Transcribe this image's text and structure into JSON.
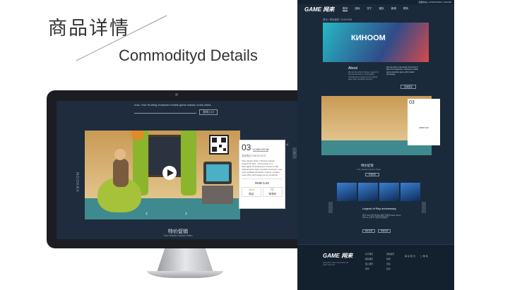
{
  "header": {
    "title_zh": "商品详情",
    "title_en": "Commodityd Details"
  },
  "monitor": {
    "top_text": "now, Your Hunting character mobile game classic cross china",
    "top_button": "游戏入口",
    "side_label": "KИHOOM",
    "card": {
      "number": "03",
      "name": "K-НИ-ОО-M",
      "sub": "游戏周边  KINOKOOTE",
      "desc": "Twin adepts artist in Shows release. Legend Of Rey - Anniversary is a thoroughly entertainment version of the original game high resolution textures, new, more detailed character models, modern most shiny technology and a smoother game",
      "price": "RMB 5.60",
      "discount": "-80%",
      "buy_label": "购买",
      "cart_label": "购物车"
    },
    "promo_zh": "特价促销",
    "promo_en": "Your Hands Games Team",
    "arrow_left": "‹",
    "arrow_right": "›"
  },
  "rpage": {
    "topbar": "  收藏本站   |   APORNORHU   |   ENTER",
    "logo": "GAME 网来",
    "nav": [
      "首页",
      "游戏",
      "关于",
      "团队",
      "新闻",
      "联系"
    ],
    "crumb": "首页 / 角色道具 / KИHOOM",
    "banner_text": "КИНООМ",
    "about_title": "About",
    "about_p": "We are the artist in shows. Legend of Rey Anniversary is a thoroughly entertainment version of the original game high resolution textures.",
    "about_p2": "We are artist in the Hunter Kin-Hood of Best Ore characters. Character models and a smoother game with modern technology.",
    "about_btn": "查看更多",
    "promo_zh": "特价促销",
    "promo_en": "Your Hands Games Team",
    "promo_btn": "查看更多",
    "legend_title": "Legend of Rey anniversary",
    "legend_p": "发行 2016   发行商 Big 游戏   开发商 Kailoo Remo Games 平台 PC 类型 角色扮演",
    "legend_btn1": "购买游戏",
    "legend_btn2": "查看详情",
    "footer_logo": "GAME 网来",
    "footer_copy": "www.2016 Gate Corporation All rights reserved",
    "footer_col1": [
      "关于我们",
      "联系我们",
      "加入我们",
      "合作"
    ],
    "footer_col2": [
      "游戏资讯",
      "新闻",
      "活动",
      "论坛"
    ],
    "footer_head": "联系我们 · 二维码"
  }
}
